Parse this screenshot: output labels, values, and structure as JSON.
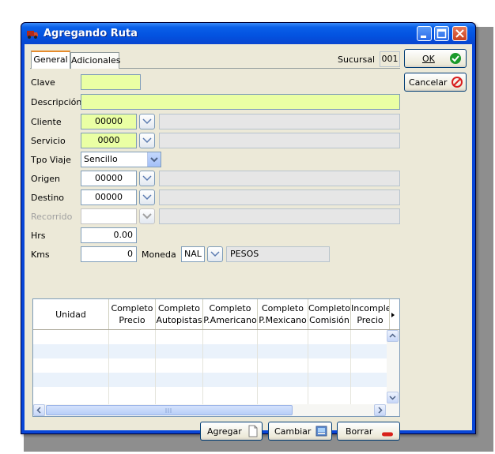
{
  "window": {
    "title": "Agregando Ruta"
  },
  "tabs": [
    {
      "label": "General"
    },
    {
      "label": "Adicionales"
    }
  ],
  "sucursal": {
    "label": "Sucursal",
    "value": "001"
  },
  "buttons": {
    "ok": "OK",
    "cancelar": "Cancelar",
    "agregar": "Agregar",
    "cambiar": "Cambiar",
    "borrar": "Borrar"
  },
  "fields": {
    "clave": {
      "label": "Clave",
      "value": ""
    },
    "descripcion": {
      "label": "Descripción",
      "value": ""
    },
    "cliente": {
      "label": "Cliente",
      "value": "00000",
      "desc": ""
    },
    "servicio": {
      "label": "Servicio",
      "value": "0000",
      "desc": ""
    },
    "tpo_viaje": {
      "label": "Tpo Viaje",
      "value": "Sencillo"
    },
    "origen": {
      "label": "Origen",
      "value": "00000",
      "desc": ""
    },
    "destino": {
      "label": "Destino",
      "value": "00000",
      "desc": ""
    },
    "recorrido": {
      "label": "Recorrido",
      "value": "",
      "desc": ""
    },
    "hrs": {
      "label": "Hrs",
      "value": "0.00"
    },
    "kms": {
      "label": "Kms",
      "value": "0"
    },
    "moneda": {
      "label": "Moneda",
      "value": "NAL",
      "desc": "PESOS"
    }
  },
  "grid": {
    "columns": [
      {
        "line1": "Unidad",
        "line2": ""
      },
      {
        "line1": "Completo",
        "line2": "Precio"
      },
      {
        "line1": "Completo",
        "line2": "Autopistas"
      },
      {
        "line1": "Completo",
        "line2": "P.Americano"
      },
      {
        "line1": "Completo",
        "line2": "P.Mexicano"
      },
      {
        "line1": "Completo",
        "line2": "Comisión"
      },
      {
        "line1": "Incomple",
        "line2": "Precio"
      }
    ],
    "rows": []
  },
  "colors": {
    "required_field": "#eaffa4",
    "title_bar": "#0a5fe8",
    "dialog_bg": "#ece9d8"
  }
}
